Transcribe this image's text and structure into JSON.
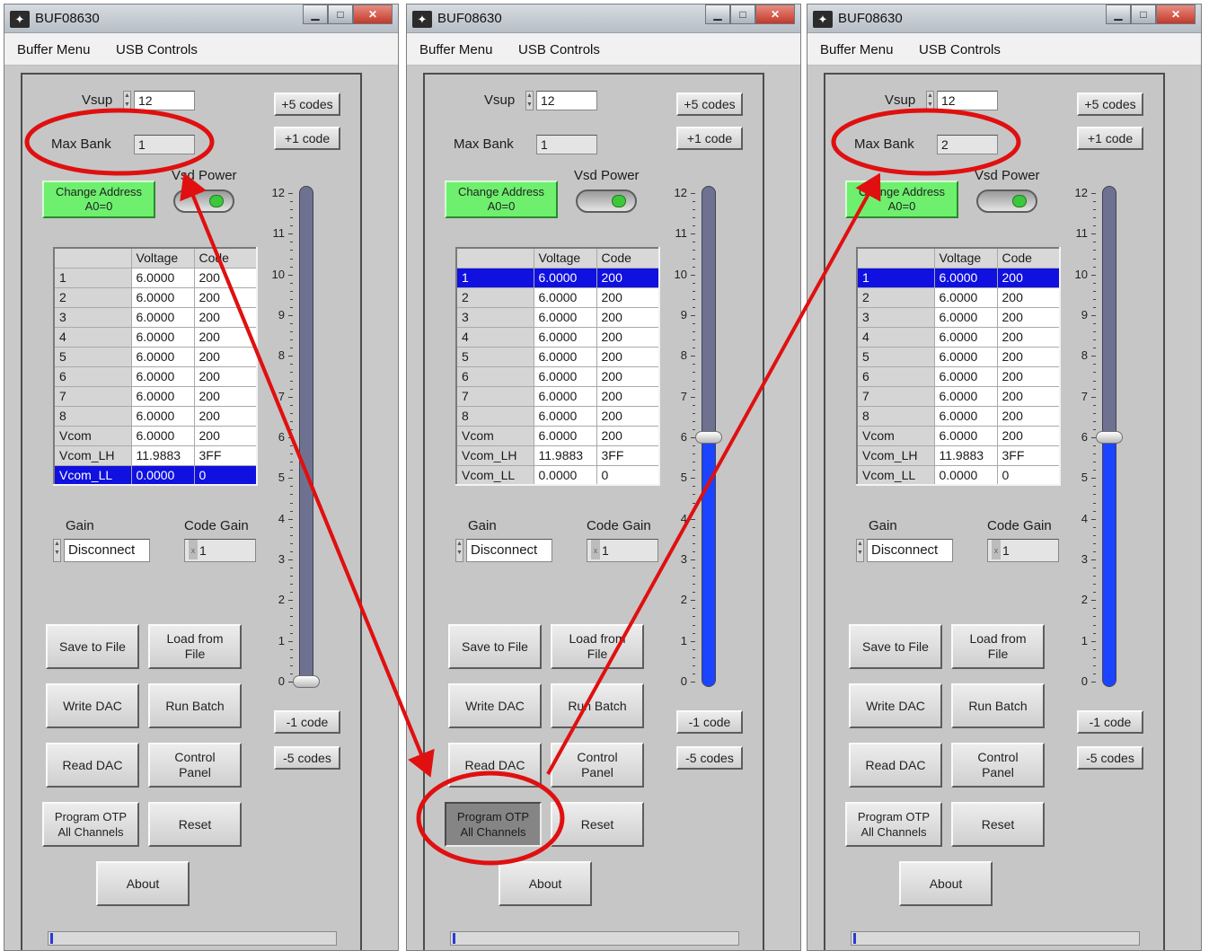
{
  "windows": [
    {
      "title": "BUF08630",
      "menu": [
        "Buffer Menu",
        "USB Controls"
      ],
      "vsup_label": "Vsup",
      "vsup_value": "12",
      "max_bank_label": "Max Bank",
      "max_bank_value": "1",
      "change_address_label": "Change Address\nA0=0",
      "vsd_power_label": "Vsd Power",
      "plus5_label": "+5 codes",
      "plus1_label": "+1 code",
      "minus1_label": "-1 code",
      "minus5_label": "-5 codes",
      "table_headers": [
        "",
        "Voltage",
        "Code"
      ],
      "table_rows": [
        [
          "1",
          "6.0000",
          "200"
        ],
        [
          "2",
          "6.0000",
          "200"
        ],
        [
          "3",
          "6.0000",
          "200"
        ],
        [
          "4",
          "6.0000",
          "200"
        ],
        [
          "5",
          "6.0000",
          "200"
        ],
        [
          "6",
          "6.0000",
          "200"
        ],
        [
          "7",
          "6.0000",
          "200"
        ],
        [
          "8",
          "6.0000",
          "200"
        ],
        [
          "Vcom",
          "6.0000",
          "200"
        ],
        [
          "Vcom_LH",
          "11.9883",
          "3FF"
        ],
        [
          "Vcom_LL",
          "0.0000",
          "0"
        ]
      ],
      "selected_row": 10,
      "gain_label": "Gain",
      "gain_value": "Disconnect",
      "code_gain_label": "Code Gain",
      "code_gain_prefix": "x",
      "code_gain_value": "1",
      "buttons": {
        "save": "Save to File",
        "load": "Load from\nFile",
        "write_dac": "Write DAC",
        "run_batch": "Run Batch",
        "read_dac": "Read DAC",
        "control_panel": "Control\nPanel",
        "program_otp": "Program OTP\nAll Channels",
        "reset": "Reset",
        "about": "About"
      },
      "program_otp_pressed": false,
      "slider_ticks": [
        "12",
        "11",
        "10",
        "9",
        "8",
        "7",
        "6",
        "5",
        "4",
        "3",
        "2",
        "1",
        "0"
      ],
      "slider_value": 0
    },
    {
      "title": "BUF08630",
      "menu": [
        "Buffer Menu",
        "USB Controls"
      ],
      "vsup_label": "Vsup",
      "vsup_value": "12",
      "max_bank_label": "Max Bank",
      "max_bank_value": "1",
      "change_address_label": "Change Address\nA0=0",
      "vsd_power_label": "Vsd Power",
      "plus5_label": "+5 codes",
      "plus1_label": "+1 code",
      "minus1_label": "-1 code",
      "minus5_label": "-5 codes",
      "table_headers": [
        "",
        "Voltage",
        "Code"
      ],
      "table_rows": [
        [
          "1",
          "6.0000",
          "200"
        ],
        [
          "2",
          "6.0000",
          "200"
        ],
        [
          "3",
          "6.0000",
          "200"
        ],
        [
          "4",
          "6.0000",
          "200"
        ],
        [
          "5",
          "6.0000",
          "200"
        ],
        [
          "6",
          "6.0000",
          "200"
        ],
        [
          "7",
          "6.0000",
          "200"
        ],
        [
          "8",
          "6.0000",
          "200"
        ],
        [
          "Vcom",
          "6.0000",
          "200"
        ],
        [
          "Vcom_LH",
          "11.9883",
          "3FF"
        ],
        [
          "Vcom_LL",
          "0.0000",
          "0"
        ]
      ],
      "selected_row": 0,
      "gain_label": "Gain",
      "gain_value": "Disconnect",
      "code_gain_label": "Code Gain",
      "code_gain_prefix": "x",
      "code_gain_value": "1",
      "buttons": {
        "save": "Save to File",
        "load": "Load from\nFile",
        "write_dac": "Write DAC",
        "run_batch": "Run Batch",
        "read_dac": "Read DAC",
        "control_panel": "Control\nPanel",
        "program_otp": "Program OTP\nAll Channels",
        "reset": "Reset",
        "about": "About"
      },
      "program_otp_pressed": true,
      "slider_ticks": [
        "12",
        "11",
        "10",
        "9",
        "8",
        "7",
        "6",
        "5",
        "4",
        "3",
        "2",
        "1",
        "0"
      ],
      "slider_value": 6
    },
    {
      "title": "BUF08630",
      "menu": [
        "Buffer Menu",
        "USB Controls"
      ],
      "vsup_label": "Vsup",
      "vsup_value": "12",
      "max_bank_label": "Max Bank",
      "max_bank_value": "2",
      "change_address_label": "Change Address\nA0=0",
      "vsd_power_label": "Vsd Power",
      "plus5_label": "+5 codes",
      "plus1_label": "+1 code",
      "minus1_label": "-1 code",
      "minus5_label": "-5 codes",
      "table_headers": [
        "",
        "Voltage",
        "Code"
      ],
      "table_rows": [
        [
          "1",
          "6.0000",
          "200"
        ],
        [
          "2",
          "6.0000",
          "200"
        ],
        [
          "3",
          "6.0000",
          "200"
        ],
        [
          "4",
          "6.0000",
          "200"
        ],
        [
          "5",
          "6.0000",
          "200"
        ],
        [
          "6",
          "6.0000",
          "200"
        ],
        [
          "7",
          "6.0000",
          "200"
        ],
        [
          "8",
          "6.0000",
          "200"
        ],
        [
          "Vcom",
          "6.0000",
          "200"
        ],
        [
          "Vcom_LH",
          "11.9883",
          "3FF"
        ],
        [
          "Vcom_LL",
          "0.0000",
          "0"
        ]
      ],
      "selected_row": 0,
      "gain_label": "Gain",
      "gain_value": "Disconnect",
      "code_gain_label": "Code Gain",
      "code_gain_prefix": "x",
      "code_gain_value": "1",
      "buttons": {
        "save": "Save to File",
        "load": "Load from\nFile",
        "write_dac": "Write DAC",
        "run_batch": "Run Batch",
        "read_dac": "Read DAC",
        "control_panel": "Control\nPanel",
        "program_otp": "Program OTP\nAll Channels",
        "reset": "Reset",
        "about": "About"
      },
      "program_otp_pressed": false,
      "slider_ticks": [
        "12",
        "11",
        "10",
        "9",
        "8",
        "7",
        "6",
        "5",
        "4",
        "3",
        "2",
        "1",
        "0"
      ],
      "slider_value": 6
    }
  ],
  "icons": {
    "app_logo": "ti-logo-icon",
    "minimize": "minimize-icon",
    "maximize": "maximize-icon",
    "close": "close-icon",
    "spinner": "spinner-arrows-icon",
    "led": "vsd-power-led-icon"
  },
  "colors": {
    "selection": "#1010e0",
    "slider_fill": "#1a44ff",
    "green_button": "#6ef06e",
    "annotation": "#e01010"
  }
}
